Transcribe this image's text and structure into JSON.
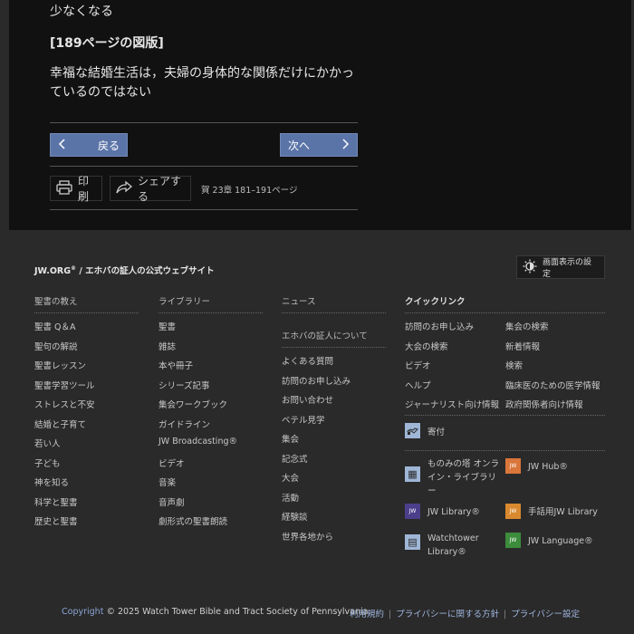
{
  "article": {
    "line1": "少なくなる",
    "caption": "[189ページの図版]",
    "body": "幸福な結婚生活は，夫婦の身体的な関係だけにかかっているのではない"
  },
  "nav": {
    "back_label": "戻る",
    "next_label": "次へ"
  },
  "tools": {
    "print_label": "印刷",
    "share_label": "シェアする",
    "reference": "賀 23章 181–191ページ"
  },
  "footer": {
    "brand_prefix": "JW.ORG",
    "brand_sup": "®",
    "brand_rest": " / エホバの証人の公式ウェブサイト",
    "display_settings": "画面表示の設定",
    "col1": {
      "heading": "聖書の教え",
      "items": [
        "聖書 Q＆A",
        "聖句の解説",
        "聖書レッスン",
        "聖書学習ツール",
        "ストレスと不安",
        "結婚と子育て",
        "若い人",
        "子ども",
        "神を知る",
        "科学と聖書",
        "歴史と聖書"
      ]
    },
    "col2": {
      "heading": "ライブラリー",
      "items": [
        "聖書",
        "雑誌",
        "本や冊子",
        "シリーズ記事",
        "集会ワークブック",
        "ガイドライン",
        "JW Broadcasting®",
        "ビデオ",
        "音楽",
        "音声劇",
        "劇形式の聖書朗読"
      ]
    },
    "col3": {
      "heading": "ニュース",
      "subheading": "エホバの証人について",
      "items": [
        "よくある質問",
        "訪問のお申し込み",
        "お問い合わせ",
        "ベテル見学",
        "集会",
        "記念式",
        "大会",
        "活動",
        "経験談",
        "世界各地から"
      ]
    },
    "quick": {
      "heading": "クイックリンク",
      "left": [
        "訪問のお申し込み",
        "大会の検索",
        "ビデオ",
        "ヘルプ",
        "ジャーナリスト向け情報"
      ],
      "right": [
        "集会の検索",
        "新着情報",
        "検索",
        "臨床医のための医学情報",
        "政府関係者向け情報"
      ],
      "donate": "寄付",
      "apps": [
        {
          "label": "ものみの塔 オンライン・ライブラリー",
          "icon": "online-library-icon",
          "color": "#9fb6d6",
          "glyph": "▦"
        },
        {
          "label": "JW Hub®",
          "icon": "jw-hub-icon",
          "color": "#d9763a",
          "glyph": "JW"
        },
        {
          "label": "JW Library®",
          "icon": "jw-library-icon",
          "color": "#4b3f8c",
          "glyph": "JW"
        },
        {
          "label": "手話用JW Library",
          "icon": "jw-library-sign-icon",
          "color": "#d9892f",
          "glyph": "JW"
        },
        {
          "label": "Watchtower Library®",
          "icon": "watchtower-library-icon",
          "color": "#9fb6d6",
          "glyph": "▤"
        },
        {
          "label": "JW Language®",
          "icon": "jw-language-icon",
          "color": "#3c8c3c",
          "glyph": "JW"
        }
      ]
    },
    "copyright_link": "Copyright",
    "copyright_text": " © 2025 Watch Tower Bible and Tract Society of Pennsylvania.",
    "legal": [
      "利用規約",
      "プライバシーに関する方針",
      "プライバシー設定"
    ]
  }
}
